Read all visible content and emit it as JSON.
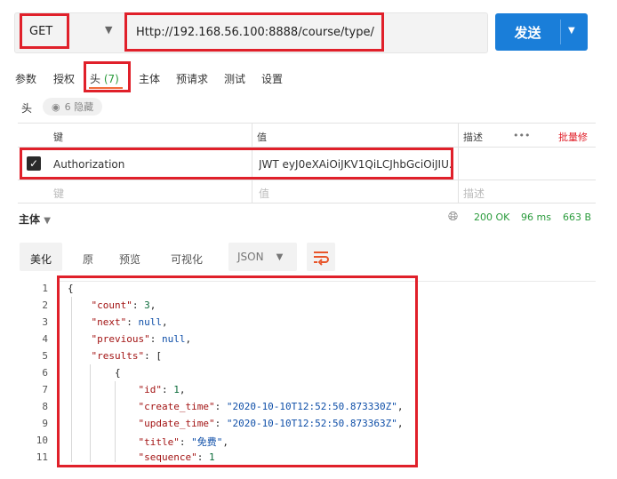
{
  "request": {
    "method": "GET",
    "url": "Http://192.168.56.100:8888/course/type/",
    "send_label": "发送"
  },
  "tabs": {
    "params": "参数",
    "auth": "授权",
    "headers": "头",
    "headers_count": "(7)",
    "body": "主体",
    "prerequest": "预请求",
    "tests": "测试",
    "settings": "设置"
  },
  "headers_section": {
    "label": "头",
    "hidden": "6 隐藏",
    "columns": {
      "key": "键",
      "value": "值",
      "description": "描述",
      "more": "•••",
      "bulk_edit": "批量修"
    },
    "row": {
      "key": "Authorization",
      "value": "JWT eyJ0eXAiOiJKV1QiLCJhbGciOiJIU..."
    },
    "placeholder": {
      "key": "键",
      "value": "值",
      "description": "描述"
    }
  },
  "response": {
    "title": "主体",
    "status": "200 OK",
    "time": "96 ms",
    "size": "663 B",
    "views": {
      "pretty": "美化",
      "raw": "原",
      "preview": "预览",
      "visualize": "可视化"
    },
    "format": "JSON"
  },
  "code_lines": [
    {
      "n": "1"
    },
    {
      "n": "2"
    },
    {
      "n": "3"
    },
    {
      "n": "4"
    },
    {
      "n": "5"
    },
    {
      "n": "6"
    },
    {
      "n": "7"
    },
    {
      "n": "8"
    },
    {
      "n": "9"
    },
    {
      "n": "10"
    },
    {
      "n": "11"
    }
  ],
  "json": {
    "count_key": "\"count\"",
    "count_val": "3",
    "next_key": "\"next\"",
    "next_val": "null",
    "previous_key": "\"previous\"",
    "previous_val": "null",
    "results_key": "\"results\"",
    "id_key": "\"id\"",
    "id_val": "1",
    "create_key": "\"create_time\"",
    "create_val": "\"2020-10-10T12:52:50.873330Z\"",
    "update_key": "\"update_time\"",
    "update_val": "\"2020-10-10T12:52:50.873363Z\"",
    "title_key": "\"title\"",
    "title_val": "\"免费\"",
    "sequence_key": "\"sequence\"",
    "sequence_val": "1"
  },
  "colors": {
    "accent": "#1a7ed9",
    "highlight": "#e0202a",
    "ok": "#2a9b3c",
    "active_tab": "#f26b3a"
  }
}
